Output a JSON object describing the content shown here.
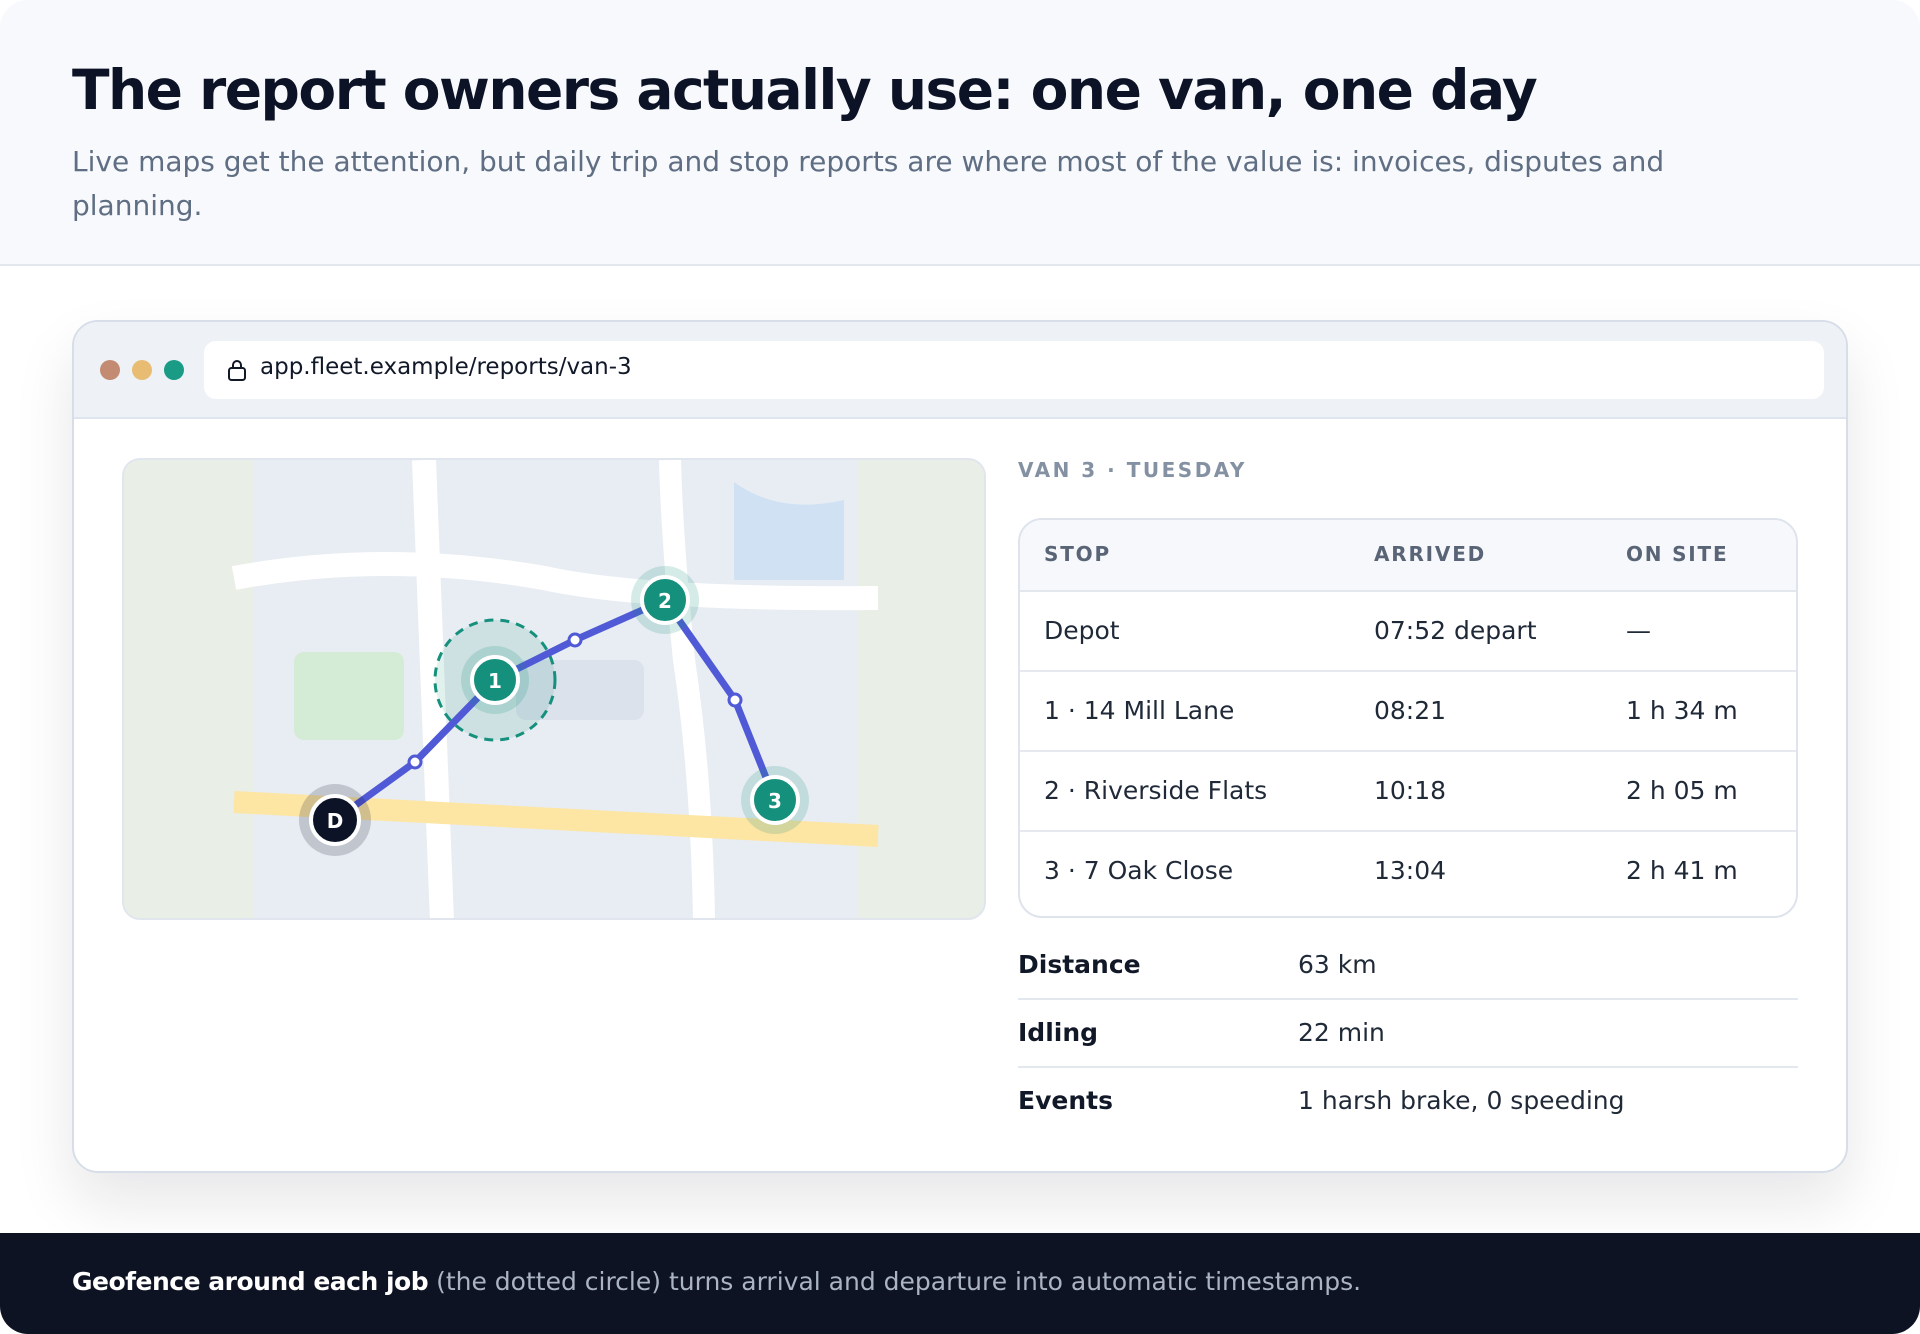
{
  "header": {
    "title": "The report owners actually use: one van, one day",
    "subtitle": "Live maps get the attention, but daily trip and stop reports are where most of the value is: invoices, disputes and planning."
  },
  "browser": {
    "url": "app.fleet.example/reports/van-3",
    "icons": {
      "lock": "lock-icon"
    }
  },
  "map": {
    "markers": {
      "depot": "D",
      "stop1": "1",
      "stop2": "2",
      "stop3": "3"
    },
    "colors": {
      "route": "#5059d6",
      "stop": "#15907c",
      "depot": "#0d1326",
      "geofence": "#15907c"
    }
  },
  "report": {
    "label": "VAN 3 · TUESDAY",
    "columns": [
      "STOP",
      "ARRIVED",
      "ON SITE"
    ],
    "rows": [
      {
        "stop": "Depot",
        "arrived": "07:52 depart",
        "on_site": "—"
      },
      {
        "stop": "1 · 14 Mill Lane",
        "arrived": "08:21",
        "on_site": "1 h 34 m"
      },
      {
        "stop": "2 · Riverside Flats",
        "arrived": "10:18",
        "on_site": "2 h 05 m"
      },
      {
        "stop": "3 · 7 Oak Close",
        "arrived": "13:04",
        "on_site": "2 h 41 m"
      }
    ],
    "summary": [
      {
        "key": "Distance",
        "value": "63 km"
      },
      {
        "key": "Idling",
        "value": "22 min"
      },
      {
        "key": "Events",
        "value": "1 harsh brake, 0 speeding"
      }
    ]
  },
  "footer": {
    "strong": "Geofence around each job",
    "rest": " (the dotted circle) turns arrival and departure into automatic timestamps."
  }
}
